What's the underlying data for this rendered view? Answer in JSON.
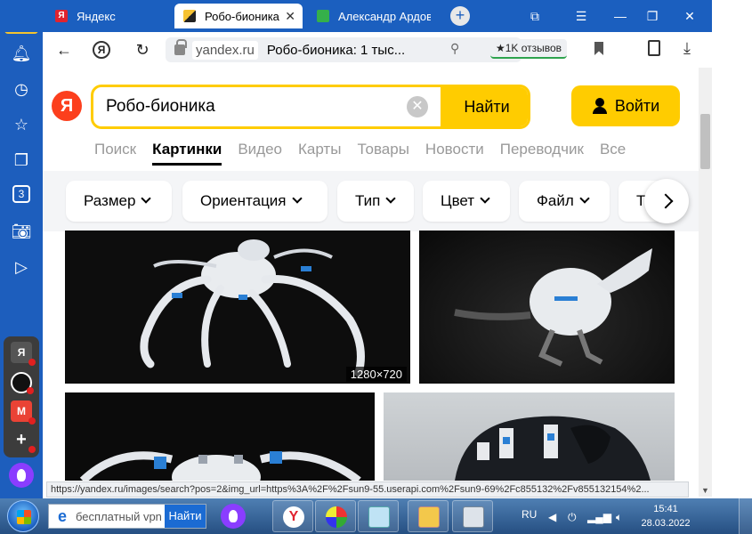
{
  "tabs": [
    {
      "label": "Яндекс",
      "favicon": "Я"
    },
    {
      "label": "Робо-бионика"
    },
    {
      "label": "Александр Ардов"
    }
  ],
  "window_controls": {
    "collections": "⧉",
    "menu": "☰",
    "minimize": "—",
    "restore": "❐",
    "close": "✕"
  },
  "sidebar": {
    "login_badge": "Войти",
    "app_tile_1": "3",
    "app_yandex": "Я"
  },
  "address_bar": {
    "domain": "yandex.ru",
    "title": "Робо-бионика: 1 тыс...",
    "reviews": "★1K отзывов"
  },
  "search": {
    "logo": "Я",
    "query": "Робо-бионика",
    "submit_label": "Найти",
    "login_label": "Войти"
  },
  "services": [
    "Поиск",
    "Картинки",
    "Видео",
    "Карты",
    "Товары",
    "Новости",
    "Переводчик",
    "Все"
  ],
  "filters": [
    "Размер",
    "Ориентация",
    "Тип",
    "Цвет",
    "Файл",
    "Т"
  ],
  "results": [
    {
      "resolution": "1280×720"
    }
  ],
  "status_url": "https://yandex.ru/images/search?pos=2&img_url=https%3A%2F%2Fsun9-55.userapi.com%2Fsun9-69%2Fc855132%2Fv855132154%2...",
  "taskbar": {
    "search_placeholder": "бесплатный vpn",
    "search_button": "Найти",
    "language": "RU",
    "time": "15:41",
    "date": "28.03.2022"
  },
  "colors": {
    "accent_yellow": "#ffcc00",
    "browser_blue": "#1b5fbf",
    "yandex_red": "#fc3f1d"
  }
}
